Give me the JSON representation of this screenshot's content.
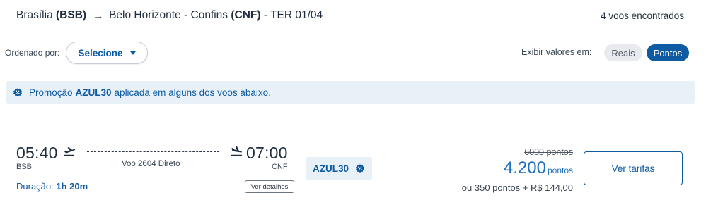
{
  "header": {
    "origin_city": "Brasília",
    "origin_code": "(BSB)",
    "destination_city": "Belo Horizonte - Confins",
    "destination_code": "(CNF)",
    "date": "- TER 01/04",
    "flights_found": "4 voos encontrados",
    "icons": {
      "route_arrow": "right-arrow-icon"
    }
  },
  "sort": {
    "label": "Ordenado por:",
    "value": "Selecione",
    "icon": "chevron-down-icon"
  },
  "currency_toggle": {
    "label": "Exibir valores em:",
    "options": [
      "Reais",
      "Pontos"
    ],
    "selected": "Pontos"
  },
  "promo_banner": {
    "prefix": "Promoção",
    "code": "AZUL30",
    "suffix": "aplicada em alguns dos voos abaixo.",
    "icon": "discount-badge-icon"
  },
  "flight": {
    "departure_time": "05:40",
    "departure_code": "BSB",
    "arrival_time": "07:00",
    "arrival_code": "CNF",
    "flight_info": "Voo 2604 Direto",
    "duration_label": "Duração:",
    "duration_value": "1h 20m",
    "details_button": "Ver detalhes",
    "promo_tag": "AZUL30",
    "original_price": "6000 pontos",
    "price_value": "4.200",
    "price_unit": "pontos",
    "alternative_price": "ou 350 pontos + R$ 144,00",
    "fares_button": "Ver tarifas",
    "icons": {
      "departure": "takeoff-plane-icon",
      "arrival": "landing-plane-icon",
      "promo": "discount-badge-icon"
    }
  },
  "colors": {
    "accent": "#0e5aa3",
    "price": "#1d6fc0",
    "banner_bg": "#e9f1f8",
    "text": "#1f2d3d"
  }
}
